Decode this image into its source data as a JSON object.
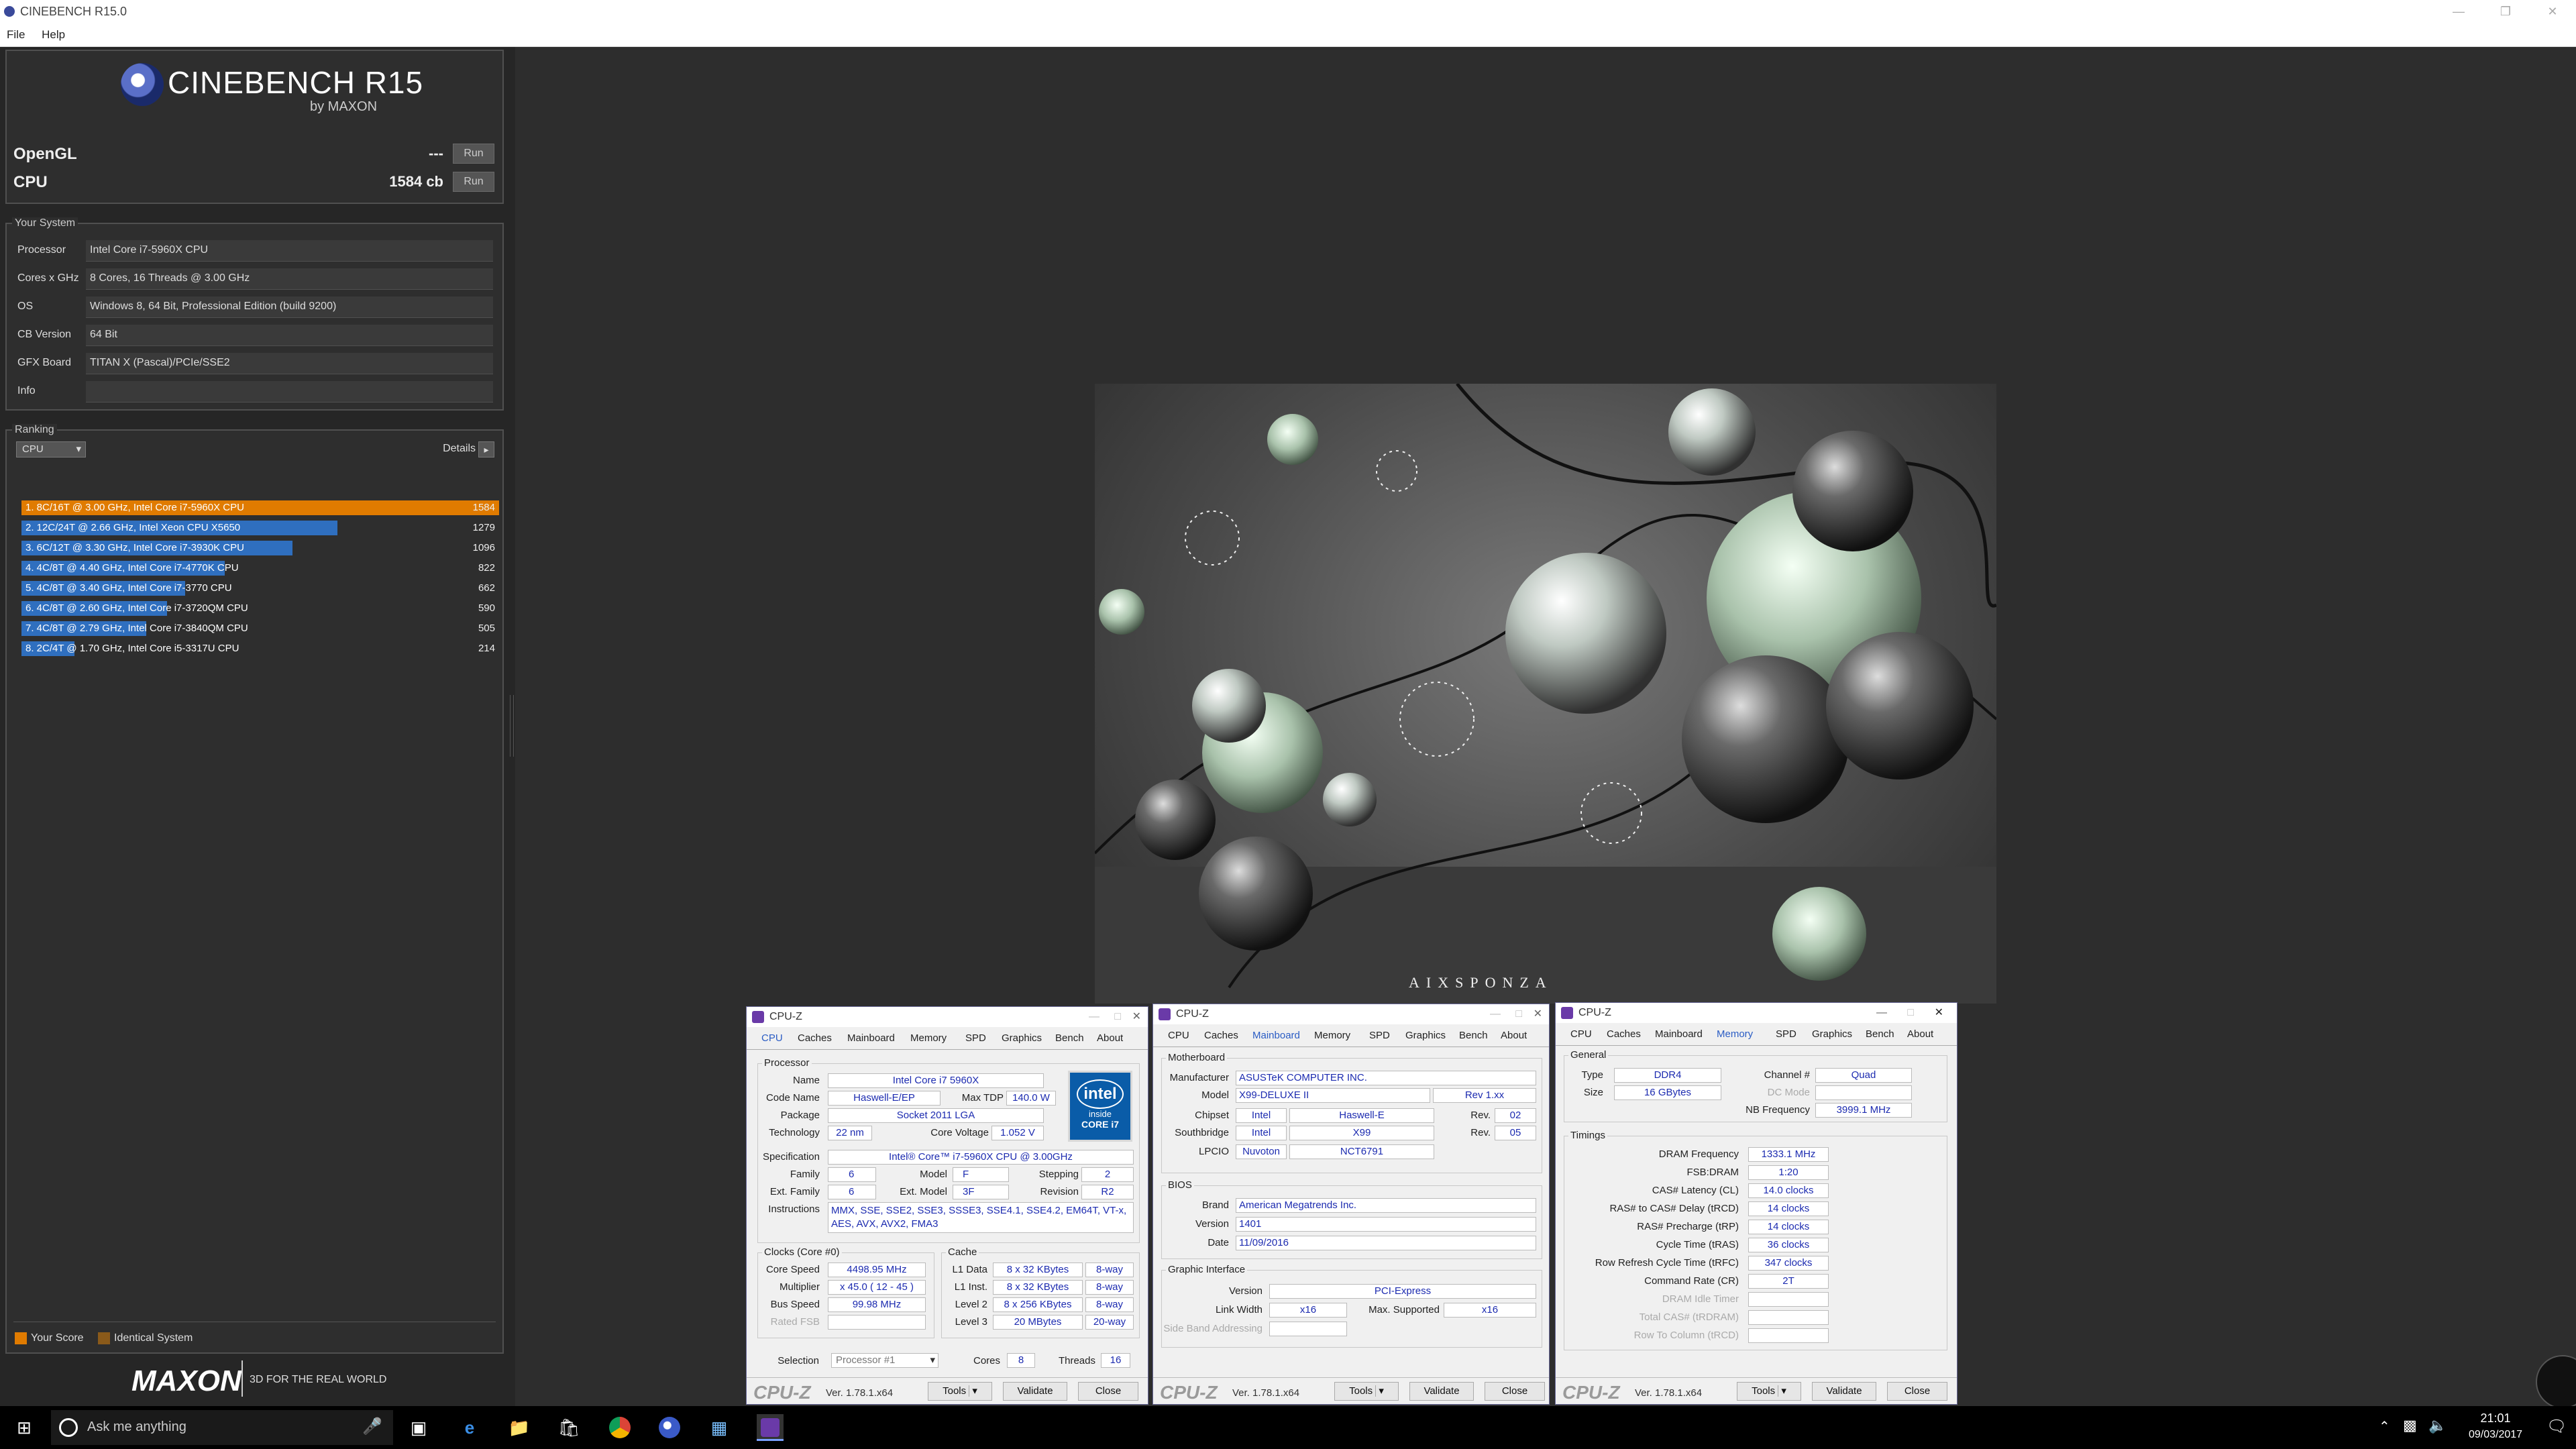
{
  "window": {
    "title": "CINEBENCH R15.0",
    "menu": [
      "File",
      "Help"
    ]
  },
  "logo": {
    "name": "CINEBENCH R15",
    "by": "by MAXON"
  },
  "benchmarks": [
    {
      "label": "OpenGL",
      "score": "---",
      "button": "Run"
    },
    {
      "label": "CPU",
      "score": "1584 cb",
      "button": "Run"
    }
  ],
  "your_system": {
    "heading": "Your System",
    "rows": [
      {
        "label": "Processor",
        "value": "Intel Core i7-5960X CPU"
      },
      {
        "label": "Cores x GHz",
        "value": "8 Cores, 16 Threads @ 3.00 GHz"
      },
      {
        "label": "OS",
        "value": "Windows 8, 64 Bit, Professional Edition (build 9200)"
      },
      {
        "label": "CB Version",
        "value": "64 Bit"
      },
      {
        "label": "GFX Board",
        "value": "TITAN X (Pascal)/PCIe/SSE2"
      },
      {
        "label": "Info",
        "value": ""
      }
    ]
  },
  "ranking": {
    "heading": "Ranking",
    "dropdown": "CPU",
    "details": "Details",
    "max_score": 1584,
    "rows": [
      {
        "text": "1. 8C/16T @ 3.00 GHz, Intel Core i7-5960X CPU",
        "score": 1584,
        "highlight": true
      },
      {
        "text": "2. 12C/24T @ 2.66 GHz, Intel Xeon CPU X5650",
        "score": 1279,
        "highlight": false
      },
      {
        "text": "3. 6C/12T @ 3.30 GHz,  Intel Core i7-3930K CPU",
        "score": 1096,
        "highlight": false
      },
      {
        "text": "4. 4C/8T @ 4.40 GHz, Intel Core i7-4770K CPU",
        "score": 822,
        "highlight": false
      },
      {
        "text": "5. 4C/8T @ 3.40 GHz,  Intel Core i7-3770 CPU",
        "score": 662,
        "highlight": false
      },
      {
        "text": "6. 4C/8T @ 2.60 GHz, Intel Core i7-3720QM CPU",
        "score": 590,
        "highlight": false
      },
      {
        "text": "7. 4C/8T @ 2.79 GHz,  Intel Core i7-3840QM CPU",
        "score": 505,
        "highlight": false
      },
      {
        "text": "8. 2C/4T @ 1.70 GHz,  Intel Core i5-3317U CPU",
        "score": 214,
        "highlight": false
      }
    ],
    "legend": [
      "Your Score",
      "Identical System"
    ]
  },
  "footer": {
    "brand": "MAXON",
    "tagline": "3D FOR THE REAL WORLD"
  },
  "render": {
    "watermark": "AIXSPONZA"
  },
  "colors": {
    "highlight": "#e07b00",
    "bar": "#2f6fbf",
    "bar_dim": "#1f4f8f"
  },
  "cpuz_cpu": {
    "title": "CPU-Z",
    "tabs": [
      "CPU",
      "Caches",
      "Mainboard",
      "Memory",
      "SPD",
      "Graphics",
      "Bench",
      "About"
    ],
    "processor_label": "Processor",
    "name": {
      "label": "Name",
      "value": "Intel Core i7 5960X"
    },
    "code_name": {
      "label": "Code Name",
      "value": "Haswell-E/EP"
    },
    "max_tdp": {
      "label": "Max TDP",
      "value": "140.0 W"
    },
    "package": {
      "label": "Package",
      "value": "Socket 2011 LGA"
    },
    "technology": {
      "label": "Technology",
      "value": "22 nm"
    },
    "core_voltage": {
      "label": "Core Voltage",
      "value": "1.052 V"
    },
    "specification": {
      "label": "Specification",
      "value": "Intel® Core™ i7-5960X CPU @ 3.00GHz"
    },
    "family": {
      "label": "Family",
      "value": "6"
    },
    "model": {
      "label": "Model",
      "value": "F"
    },
    "stepping": {
      "label": "Stepping",
      "value": "2"
    },
    "ext_family": {
      "label": "Ext. Family",
      "value": "6"
    },
    "ext_model": {
      "label": "Ext. Model",
      "value": "3F"
    },
    "revision": {
      "label": "Revision",
      "value": "R2"
    },
    "instructions": {
      "label": "Instructions",
      "value": "MMX, SSE, SSE2, SSE3, SSSE3, SSE4.1, SSE4.2, EM64T, VT-x, AES, AVX, AVX2, FMA3"
    },
    "clocks_label": "Clocks (Core #0)",
    "core_speed": {
      "label": "Core Speed",
      "value": "4498.95 MHz"
    },
    "multiplier": {
      "label": "Multiplier",
      "value": "x 45.0 ( 12 - 45 )"
    },
    "bus_speed": {
      "label": "Bus Speed",
      "value": "99.98 MHz"
    },
    "rated_fsb": {
      "label": "Rated FSB",
      "value": ""
    },
    "cache_label": "Cache",
    "l1_data": {
      "label": "L1 Data",
      "value": "8 x 32 KBytes",
      "way": "8-way"
    },
    "l1_inst": {
      "label": "L1 Inst.",
      "value": "8 x 32 KBytes",
      "way": "8-way"
    },
    "level2": {
      "label": "Level 2",
      "value": "8 x 256 KBytes",
      "way": "8-way"
    },
    "level3": {
      "label": "Level 3",
      "value": "20 MBytes",
      "way": "20-way"
    },
    "selection": {
      "label": "Selection",
      "value": "Processor #1"
    },
    "cores": {
      "label": "Cores",
      "value": "8"
    },
    "threads": {
      "label": "Threads",
      "value": "16"
    },
    "intel_badge": {
      "brand": "intel",
      "line1": "inside",
      "line2": "CORE i7"
    },
    "footer": {
      "logo": "CPU-Z",
      "version": "Ver. 1.78.1.x64",
      "tools": "Tools",
      "validate": "Validate",
      "close": "Close"
    }
  },
  "cpuz_mainboard": {
    "title": "CPU-Z",
    "tabs": [
      "CPU",
      "Caches",
      "Mainboard",
      "Memory",
      "SPD",
      "Graphics",
      "Bench",
      "About"
    ],
    "motherboard_label": "Motherboard",
    "manufacturer": {
      "label": "Manufacturer",
      "value": "ASUSTeK COMPUTER INC."
    },
    "model": {
      "label": "Model",
      "value": "X99-DELUXE II",
      "rev": "Rev 1.xx"
    },
    "chipset": {
      "label": "Chipset",
      "vendor": "Intel",
      "value": "Haswell-E",
      "rev_label": "Rev.",
      "rev": "02"
    },
    "southbridge": {
      "label": "Southbridge",
      "vendor": "Intel",
      "value": "X99",
      "rev_label": "Rev.",
      "rev": "05"
    },
    "lpcio": {
      "label": "LPCIO",
      "vendor": "Nuvoton",
      "value": "NCT6791"
    },
    "bios_label": "BIOS",
    "brand": {
      "label": "Brand",
      "value": "American Megatrends Inc."
    },
    "version": {
      "label": "Version",
      "value": "1401"
    },
    "date": {
      "label": "Date",
      "value": "11/09/2016"
    },
    "graphic_label": "Graphic Interface",
    "gi_version": {
      "label": "Version",
      "value": "PCI-Express"
    },
    "link_width": {
      "label": "Link Width",
      "value": "x16"
    },
    "max_supported": {
      "label": "Max. Supported",
      "value": "x16"
    },
    "side_band": {
      "label": "Side Band Addressing"
    },
    "footer": {
      "logo": "CPU-Z",
      "version": "Ver. 1.78.1.x64",
      "tools": "Tools",
      "validate": "Validate",
      "close": "Close"
    }
  },
  "cpuz_memory": {
    "title": "CPU-Z",
    "tabs": [
      "CPU",
      "Caches",
      "Mainboard",
      "Memory",
      "SPD",
      "Graphics",
      "Bench",
      "About"
    ],
    "general_label": "General",
    "type": {
      "label": "Type",
      "value": "DDR4"
    },
    "channel": {
      "label": "Channel #",
      "value": "Quad"
    },
    "size": {
      "label": "Size",
      "value": "16 GBytes"
    },
    "dc_mode": {
      "label": "DC Mode"
    },
    "nb_frequency": {
      "label": "NB Frequency",
      "value": "3999.1 MHz"
    },
    "timings_label": "Timings",
    "timings": [
      {
        "label": "DRAM Frequency",
        "value": "1333.1 MHz",
        "active": true
      },
      {
        "label": "FSB:DRAM",
        "value": "1:20",
        "active": true
      },
      {
        "label": "CAS# Latency (CL)",
        "value": "14.0 clocks",
        "active": true
      },
      {
        "label": "RAS# to CAS# Delay (tRCD)",
        "value": "14 clocks",
        "active": true
      },
      {
        "label": "RAS# Precharge (tRP)",
        "value": "14 clocks",
        "active": true
      },
      {
        "label": "Cycle Time (tRAS)",
        "value": "36 clocks",
        "active": true
      },
      {
        "label": "Row Refresh Cycle Time (tRFC)",
        "value": "347 clocks",
        "active": true
      },
      {
        "label": "Command Rate (CR)",
        "value": "2T",
        "active": true
      },
      {
        "label": "DRAM Idle Timer",
        "value": "",
        "active": false
      },
      {
        "label": "Total CAS# (tRDRAM)",
        "value": "",
        "active": false
      },
      {
        "label": "Row To Column (tRCD)",
        "value": "",
        "active": false
      }
    ],
    "footer": {
      "logo": "CPU-Z",
      "version": "Ver. 1.78.1.x64",
      "tools": "Tools",
      "validate": "Validate",
      "close": "Close"
    }
  },
  "taskbar": {
    "search_placeholder": "Ask me anything",
    "icons": [
      "start-icon",
      "search-icon",
      "microphone-icon",
      "task-view-icon",
      "edge-icon",
      "file-explorer-icon",
      "store-icon",
      "chrome-icon",
      "cinebench-icon",
      "app-icon",
      "cpuz-icon"
    ],
    "time": "21:01",
    "date": "09/03/2017"
  }
}
